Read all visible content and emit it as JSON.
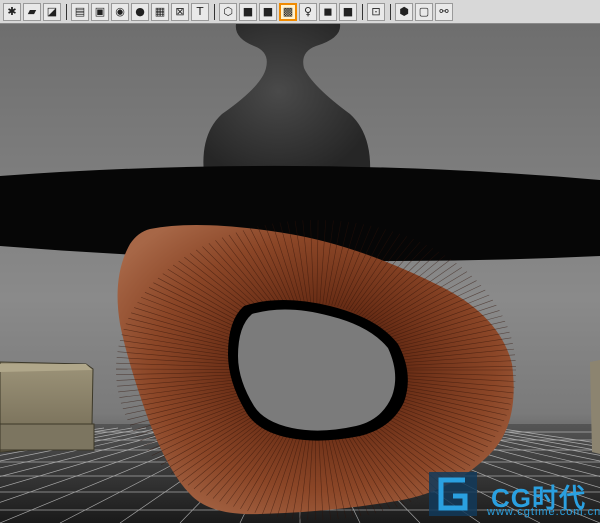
{
  "toolbar": {
    "buttons": [
      {
        "icon": "paint-spider-icon",
        "glyph": "✱"
      },
      {
        "icon": "brown-box-icon",
        "glyph": "▰"
      },
      {
        "icon": "green-plane-icon",
        "glyph": "◪"
      },
      {
        "sep": true
      },
      {
        "icon": "grid-layers-icon",
        "glyph": "▤"
      },
      {
        "icon": "display-window-icon",
        "glyph": "▣"
      },
      {
        "icon": "blue-sphere-icon",
        "glyph": "◉"
      },
      {
        "icon": "beige-circle-icon",
        "glyph": "●"
      },
      {
        "icon": "checker-grid-icon",
        "glyph": "▦"
      },
      {
        "icon": "image-plane-icon",
        "glyph": "⊠"
      },
      {
        "icon": "text-icon",
        "glyph": "T"
      },
      {
        "sep": true
      },
      {
        "icon": "wire-cube-icon",
        "glyph": "⬡"
      },
      {
        "icon": "shaded-blue-cube-icon",
        "glyph": "■"
      },
      {
        "icon": "gray-cube-icon",
        "glyph": "■"
      },
      {
        "icon": "textured-cube-icon",
        "glyph": "▩",
        "active": true
      },
      {
        "icon": "light-bulb-icon",
        "glyph": "♀"
      },
      {
        "icon": "lit-cube-icon",
        "glyph": "◼"
      },
      {
        "icon": "red-cube-icon",
        "glyph": "■"
      },
      {
        "sep": true
      },
      {
        "icon": "resolution-gate-icon",
        "glyph": "⊡"
      },
      {
        "sep": true
      },
      {
        "icon": "isolate-cube-icon",
        "glyph": "⬢"
      },
      {
        "icon": "frame-icon",
        "glyph": "▢"
      },
      {
        "icon": "node-link-icon",
        "glyph": "⚯"
      }
    ]
  },
  "watermark": {
    "brand": "CG时代",
    "url": "www.cgtime.com.cn"
  },
  "colors": {
    "wood_dark": "#5b2512",
    "wood_light": "#a5623f",
    "toolbar_bg": "#d8d8d8",
    "active_border": "#f08a00",
    "watermark_blue": "#2aa0e0"
  }
}
